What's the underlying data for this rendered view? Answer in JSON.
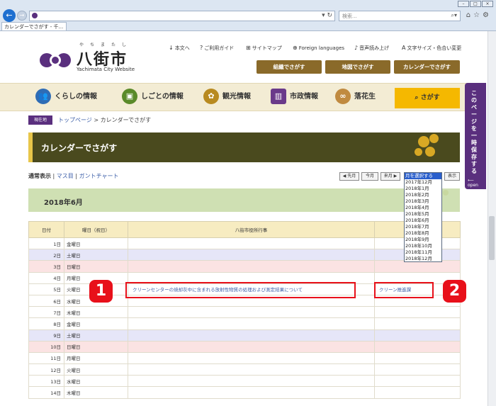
{
  "browser": {
    "tab_title": "カレンダーでさがす - 千...",
    "search_placeholder": "検索...",
    "window_buttons": [
      "–",
      "□",
      "×"
    ],
    "toolbar_icons": [
      "home-icon",
      "star-icon",
      "gear-icon"
    ]
  },
  "site": {
    "logo_kanji": "八街市",
    "logo_ruby": "やちまたし",
    "logo_en": "Yachimata City Website",
    "util_links": [
      {
        "icon": "↓",
        "label": "本文へ"
      },
      {
        "icon": "?",
        "label": "ご利用ガイド"
      },
      {
        "icon": "⊞",
        "label": "サイトマップ"
      },
      {
        "icon": "⊕",
        "label": "Foreign languages"
      },
      {
        "icon": "♪",
        "label": "音声読み上げ"
      },
      {
        "icon": "A",
        "label": "文字サイズ・色合い変更"
      }
    ],
    "header_buttons": [
      "組織でさがす",
      "地図でさがす",
      "カレンダーでさがす"
    ],
    "nav": [
      {
        "label": "くらしの情報",
        "icon": "people-icon",
        "color": "#2f6cb5"
      },
      {
        "label": "しごとの情報",
        "icon": "briefcase-icon",
        "color": "#5a8a2a"
      },
      {
        "label": "観光情報",
        "icon": "sunflower-icon",
        "color": "#b88a20"
      },
      {
        "label": "市政情報",
        "icon": "building-icon",
        "color": "#6a3a8a"
      },
      {
        "label": "落花生",
        "icon": "peanut-icon",
        "color": "#c08a40"
      }
    ],
    "nav_search": "さがす",
    "side_tab": "このページを一時保存する",
    "side_tab_open": "open"
  },
  "breadcrumb": {
    "badge": "現在地",
    "home": "トップページ",
    "sep": ">",
    "current": "カレンダーでさがす"
  },
  "page_title": "カレンダーでさがす",
  "views": {
    "active": "通常表示",
    "sep1": "|",
    "masu": "マス目",
    "sep2": "|",
    "gantt": "ガントチャート"
  },
  "month_nav": {
    "prev": "◀ 先月",
    "today": "今月",
    "next": "来月 ▶",
    "show": "表示"
  },
  "month_dropdown": {
    "options": [
      "月を選択する",
      "2017年12月",
      "2018年1月",
      "2018年2月",
      "2018年3月",
      "2018年4月",
      "2018年5月",
      "2018年6月",
      "2018年7月",
      "2018年8月",
      "2018年9月",
      "2018年10月",
      "2018年11月",
      "2018年12月"
    ],
    "selected_index": 0
  },
  "month_title": "2018年6月",
  "table": {
    "headers": [
      "日付",
      "曜日（祝日）",
      "八街市役所行事",
      ""
    ],
    "rows": [
      {
        "date": "1日",
        "dow": "金曜日",
        "event": "",
        "dept": "",
        "kind": ""
      },
      {
        "date": "2日",
        "dow": "土曜日",
        "event": "",
        "dept": "",
        "kind": "sat"
      },
      {
        "date": "3日",
        "dow": "日曜日",
        "event": "",
        "dept": "",
        "kind": "sun"
      },
      {
        "date": "4日",
        "dow": "月曜日",
        "event": "",
        "dept": "",
        "kind": ""
      },
      {
        "date": "5日",
        "dow": "火曜日",
        "event": "クリーンセンターの焼却灰中に含まれる放射性物質の処理および測定結果について",
        "dept": "クリーン推進課",
        "kind": ""
      },
      {
        "date": "6日",
        "dow": "水曜日",
        "event": "",
        "dept": "",
        "kind": ""
      },
      {
        "date": "7日",
        "dow": "木曜日",
        "event": "",
        "dept": "",
        "kind": ""
      },
      {
        "date": "8日",
        "dow": "金曜日",
        "event": "",
        "dept": "",
        "kind": ""
      },
      {
        "date": "9日",
        "dow": "土曜日",
        "event": "",
        "dept": "",
        "kind": "sat"
      },
      {
        "date": "10日",
        "dow": "日曜日",
        "event": "",
        "dept": "",
        "kind": "sun"
      },
      {
        "date": "11日",
        "dow": "月曜日",
        "event": "",
        "dept": "",
        "kind": ""
      },
      {
        "date": "12日",
        "dow": "火曜日",
        "event": "",
        "dept": "",
        "kind": ""
      },
      {
        "date": "13日",
        "dow": "水曜日",
        "event": "",
        "dept": "",
        "kind": ""
      },
      {
        "date": "14日",
        "dow": "木曜日",
        "event": "",
        "dept": "",
        "kind": ""
      }
    ]
  },
  "callouts": [
    "1",
    "2"
  ]
}
